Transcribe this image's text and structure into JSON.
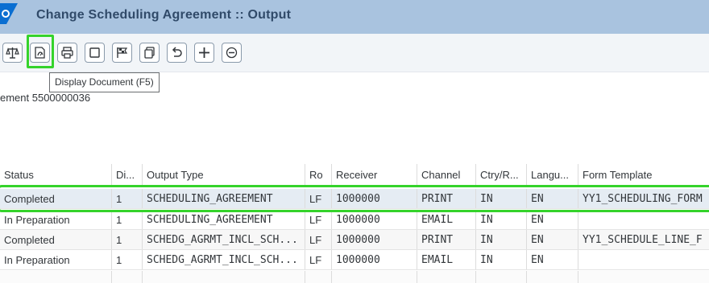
{
  "window": {
    "title": "Change Scheduling Agreement :: Output"
  },
  "toolbar": {
    "buttons": [
      {
        "icon": "balance-scale-icon"
      },
      {
        "icon": "display-document-icon"
      },
      {
        "icon": "print-icon"
      },
      {
        "icon": "frame-icon"
      },
      {
        "icon": "flag-icon"
      },
      {
        "icon": "copy-icon"
      },
      {
        "icon": "undo-icon"
      },
      {
        "icon": "add-icon"
      },
      {
        "icon": "remove-icon"
      }
    ],
    "tooltip": "Display Document (F5)"
  },
  "subtitle": "ement 5500000036",
  "table": {
    "headers": [
      "Status",
      "Di...",
      "Output Type",
      "Ro",
      "Receiver",
      "Channel",
      "Ctry/R...",
      "Langu...",
      "Form Template"
    ],
    "rows": [
      [
        "Completed",
        "1",
        "SCHEDULING_AGREEMENT",
        "LF",
        "1000000",
        "PRINT",
        "IN",
        "EN",
        "YY1_SCHEDULING_FORM"
      ],
      [
        "In Preparation",
        "1",
        "SCHEDULING_AGREEMENT",
        "LF",
        "1000000",
        "EMAIL",
        "IN",
        "EN",
        ""
      ],
      [
        "Completed",
        "1",
        "SCHEDG_AGRMT_INCL_SCH...",
        "LF",
        "1000000",
        "PRINT",
        "IN",
        "EN",
        "YY1_SCHEDULE_LINE_F"
      ],
      [
        "In Preparation",
        "1",
        "SCHEDG_AGRMT_INCL_SCH...",
        "LF",
        "1000000",
        "EMAIL",
        "IN",
        "EN",
        ""
      ]
    ]
  },
  "colors": {
    "titlebar": "#a9c3df",
    "highlight": "#35d32b",
    "selected_row": "#e5ecf3"
  }
}
